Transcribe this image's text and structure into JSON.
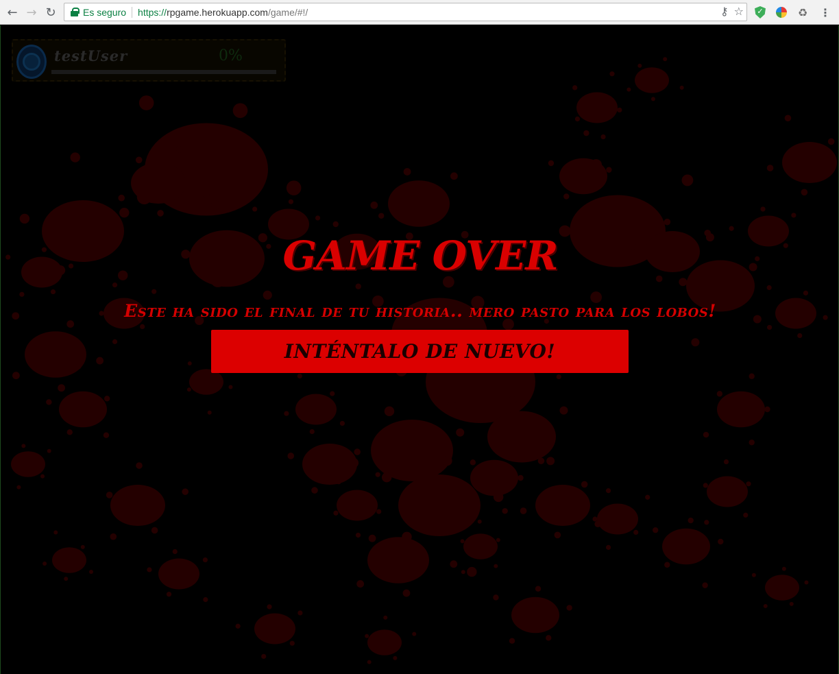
{
  "browser": {
    "back_icon": "arrow-left-icon",
    "forward_icon": "arrow-right-icon",
    "reload_icon": "reload-icon",
    "secure_label": "Es seguro",
    "url_scheme": "https://",
    "url_host": "rpgame.herokuapp.com",
    "url_path": "/game/#!/",
    "key_icon": "key-icon",
    "star_icon": "star-icon",
    "extensions": [
      "shield-extension-icon",
      "color-wheel-extension-icon",
      "recycle-extension-icon"
    ],
    "menu_icon": "kebab-menu-icon"
  },
  "hud": {
    "username": "testUser",
    "progress_label": "0%",
    "progress": 0
  },
  "game_over": {
    "title": "GAME OVER",
    "subtitle": "Este ha sido el final de tu historia.. mero pasto para los lobos!",
    "retry_label": "INTÉNTALO DE NUEVO!"
  },
  "colors": {
    "accent_red": "#dc0000",
    "splatter": "#240000",
    "background": "#000000"
  }
}
